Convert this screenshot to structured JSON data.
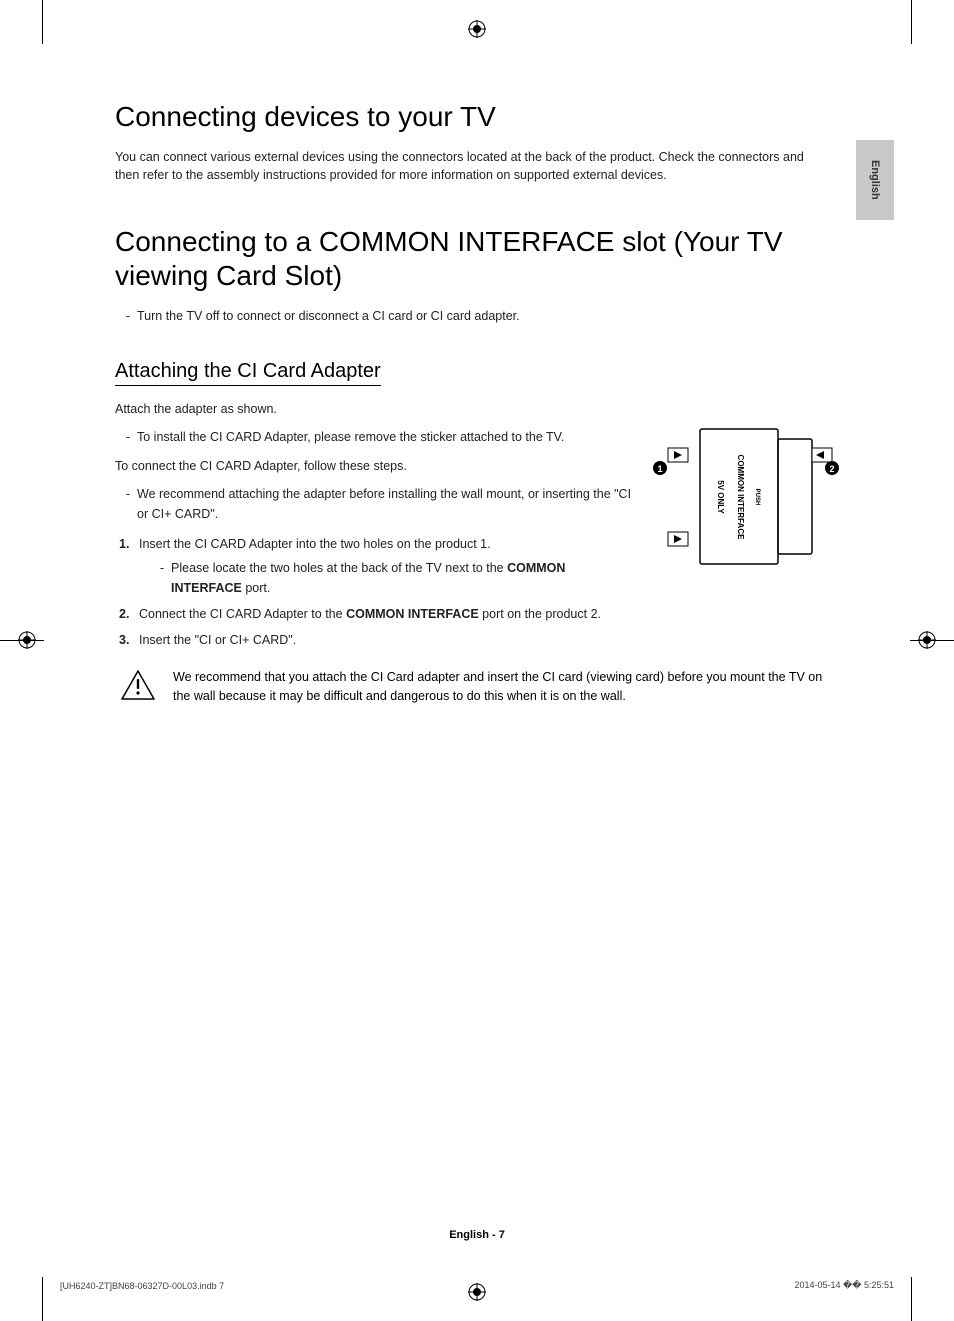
{
  "tab": {
    "language": "English"
  },
  "section1": {
    "title": "Connecting devices to your TV",
    "intro": "You can connect various external devices using the connectors located at the back of the product. Check the connectors and then refer to the assembly instructions provided for more information on supported external devices."
  },
  "section2": {
    "title": "Connecting to a COMMON INTERFACE slot (Your TV viewing Card Slot)",
    "note1": "Turn the TV off to connect or disconnect a CI card or CI card adapter."
  },
  "section3": {
    "heading": "Attaching the CI Card Adapter",
    "p1": "Attach the adapter as shown.",
    "d1": "To install the CI CARD Adapter, please remove the sticker attached to the TV.",
    "p2": "To connect the CI CARD Adapter, follow these steps.",
    "d2": "We recommend attaching the adapter before installing the wall mount, or inserting the \"CI or CI+ CARD\".",
    "steps": [
      {
        "num": "1.",
        "text": "Insert the CI CARD Adapter into the two holes on the product 1.",
        "sub_pre": "Please locate the two holes at the back of the TV next to the ",
        "sub_bold": "COMMON INTERFACE",
        "sub_post": " port."
      },
      {
        "num": "2.",
        "text_pre": "Connect the CI CARD Adapter to the ",
        "text_bold": "COMMON INTERFACE",
        "text_post": " port on the product 2."
      },
      {
        "num": "3.",
        "text": "Insert the \"CI or CI+ CARD\"."
      }
    ],
    "warning": "We recommend that you attach the CI Card adapter and insert the CI card (viewing card) before you mount the TV on the wall because it may be difficult and dangerous to do this when it is on the wall."
  },
  "figure": {
    "label_ci": "COMMON INTERFACE",
    "label_5v": "5V ONLY",
    "label_push": "PUSH",
    "callout1": "1",
    "callout2": "2"
  },
  "footer": {
    "page": "English - 7",
    "left": "[UH6240-ZT]BN68-06327D-00L03.indb   7",
    "right": "2014-05-14   �� 5:25:51"
  }
}
